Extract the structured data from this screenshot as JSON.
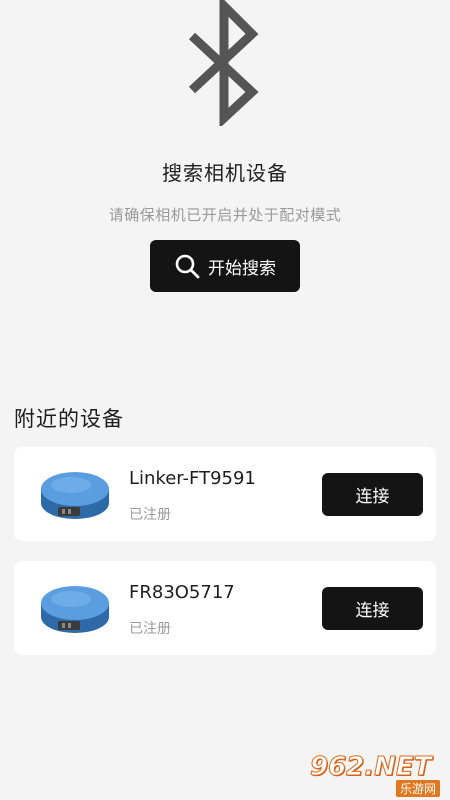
{
  "header": {
    "icon": "bluetooth-icon",
    "title": "搜索相机设备",
    "subtitle": "请确保相机已开启并处于配对模式"
  },
  "search_button": {
    "icon": "search-icon",
    "label": "开始搜索"
  },
  "nearby": {
    "section_title": "附近的设备",
    "devices": [
      {
        "name": "Linker-FT9591",
        "status": "已注册",
        "connect_label": "连接",
        "image": "camera-device-image"
      },
      {
        "name": "FR83O5717",
        "status": "已注册",
        "connect_label": "连接",
        "image": "camera-device-image"
      }
    ]
  },
  "watermark": {
    "brand": "962.NET",
    "sub": "乐游网"
  },
  "colors": {
    "background": "#f4f4f5",
    "button": "#141414",
    "device_blue": "#4a8fd6",
    "watermark_orange": "#e0781f"
  }
}
